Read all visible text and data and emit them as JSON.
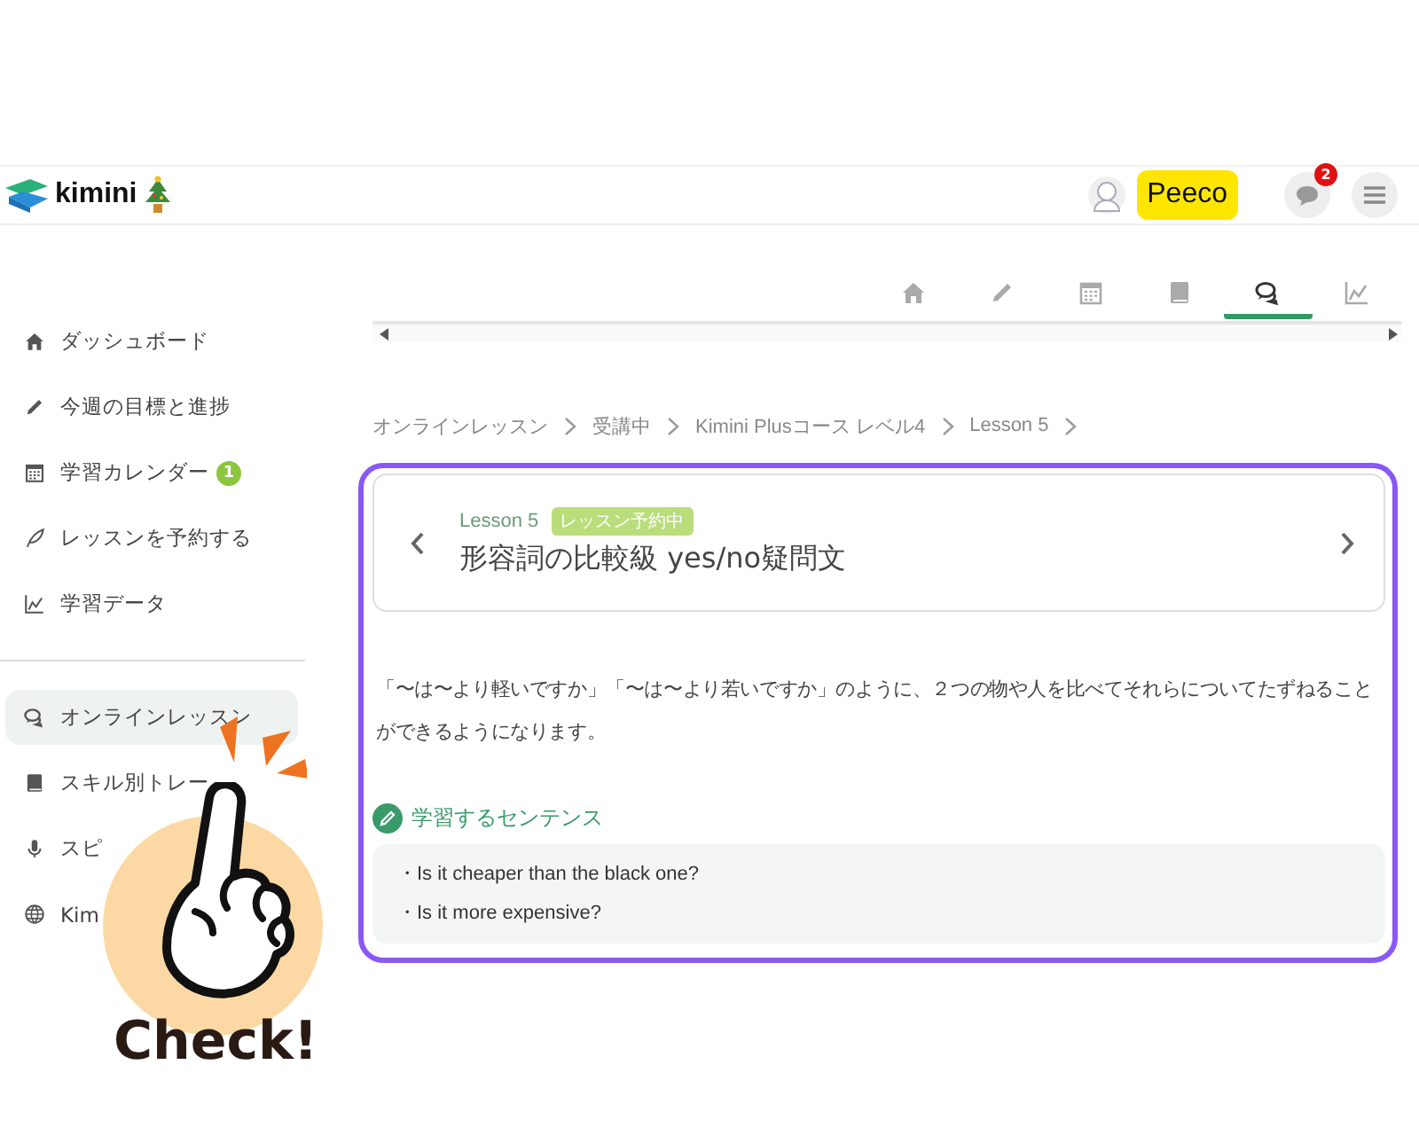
{
  "header": {
    "logo": "kimini",
    "user_name": "Peeco",
    "notification_count": "2"
  },
  "tabs": [
    {
      "kind": "home",
      "selected": false
    },
    {
      "kind": "pencil",
      "selected": false
    },
    {
      "kind": "calendar",
      "selected": false
    },
    {
      "kind": "book",
      "selected": false
    },
    {
      "kind": "chat",
      "selected": true
    },
    {
      "kind": "chart",
      "selected": false
    }
  ],
  "sidebar": {
    "groups": [
      [
        {
          "kind": "home",
          "label": "ダッシュボード",
          "selected": false
        },
        {
          "kind": "pencil",
          "label": "今週の目標と進捗",
          "selected": false
        },
        {
          "kind": "calendar",
          "label": "学習カレンダー",
          "badge": "1",
          "selected": false
        },
        {
          "kind": "feather",
          "label": "レッスンを予約する",
          "selected": false
        },
        {
          "kind": "chart",
          "label": "学習データ",
          "selected": false
        }
      ],
      [
        {
          "kind": "chat",
          "label": "オンラインレッスン",
          "selected": true
        },
        {
          "kind": "book",
          "label": "スキル別トレー",
          "selected": false
        },
        {
          "kind": "mic",
          "label": "スピ",
          "selected": false
        },
        {
          "kind": "globe",
          "label": "Kim",
          "selected": false
        }
      ]
    ]
  },
  "breadcrumb": [
    "オンラインレッスン",
    "受講中",
    "Kimini Plusコース レベル4",
    "Lesson 5"
  ],
  "lesson": {
    "number": "Lesson 5",
    "status": "レッスン予約中",
    "title": "形容詞の比較級 yes/no疑問文",
    "description": "「〜は〜より軽いですか」「〜は〜より若いですか」のように、２つの物や人を比べてそれらについてたずねることができるようになります。",
    "sentences_heading": "学習するセンテンス",
    "sentences": [
      "・Is it cheaper than the black one?",
      "・Is it more expensive?"
    ]
  },
  "sticker": {
    "caption": "Check!"
  }
}
